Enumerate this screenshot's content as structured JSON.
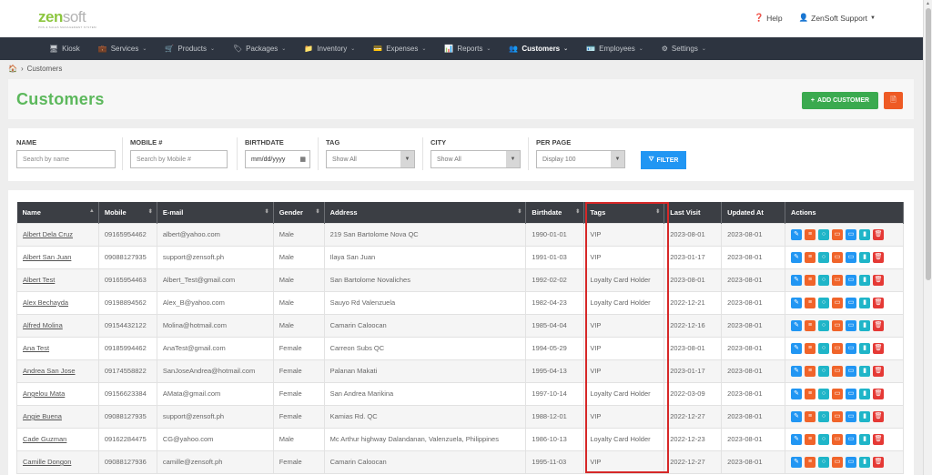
{
  "header": {
    "logo_main_a": "zen",
    "logo_main_b": "soft",
    "logo_sub": "POS & SALES MANAGEMENT SYSTEM",
    "help": "Help",
    "user": "ZenSoft Support"
  },
  "nav": {
    "items": [
      {
        "label": "Kiosk",
        "icon": "desktop-icon"
      },
      {
        "label": "Services",
        "icon": "briefcase-icon"
      },
      {
        "label": "Products",
        "icon": "cart-icon"
      },
      {
        "label": "Packages",
        "icon": "tag-icon"
      },
      {
        "label": "Inventory",
        "icon": "folder-icon"
      },
      {
        "label": "Expenses",
        "icon": "expense-icon"
      },
      {
        "label": "Reports",
        "icon": "chart-icon"
      },
      {
        "label": "Customers",
        "icon": "users-icon"
      },
      {
        "label": "Employees",
        "icon": "id-card-icon"
      },
      {
        "label": "Settings",
        "icon": "gear-icon"
      }
    ],
    "active": "Customers"
  },
  "breadcrumb": {
    "current": "Customers"
  },
  "page": {
    "title": "Customers",
    "add_label": "ADD CUSTOMER"
  },
  "filters": {
    "name": {
      "label": "NAME",
      "placeholder": "Search by name"
    },
    "mobile": {
      "label": "MOBILE #",
      "placeholder": "Search by Mobile #"
    },
    "birthdate": {
      "label": "BIRTHDATE",
      "value": "mm/dd/yyyy"
    },
    "tag": {
      "label": "TAG",
      "value": "Show All"
    },
    "city": {
      "label": "CITY",
      "value": "Show All"
    },
    "per_page": {
      "label": "PER PAGE",
      "value": "Display 100"
    },
    "button": "FILTER"
  },
  "table": {
    "headers": [
      "Name",
      "Mobile",
      "E-mail",
      "Gender",
      "Address",
      "Birthdate",
      "Tags",
      "Last Visit",
      "Updated At",
      "Actions"
    ],
    "rows": [
      [
        "Albert Dela Cruz",
        "09165954462",
        "albert@yahoo.com",
        "Male",
        "219 San Bartolome Nova QC",
        "1990-01-01",
        "VIP",
        "2023-08-01",
        "2023-08-01"
      ],
      [
        "Albert San Juan",
        "09088127935",
        "support@zensoft.ph",
        "Male",
        "Ilaya San Juan",
        "1991-01-03",
        "VIP",
        "2023-01-17",
        "2023-08-01"
      ],
      [
        "Albert Test",
        "09165954463",
        "Albert_Test@gmail.com",
        "Male",
        "San Bartolome Novaliches",
        "1992-02-02",
        "Loyalty Card Holder",
        "2023-08-01",
        "2023-08-01"
      ],
      [
        "Alex Bechayda",
        "09198894562",
        "Alex_B@yahoo.com",
        "Male",
        "Sauyo Rd Valenzuela",
        "1982-04-23",
        "Loyalty Card Holder",
        "2022-12-21",
        "2023-08-01"
      ],
      [
        "Alfred Molina",
        "09154432122",
        "Molina@hotmail.com",
        "Male",
        "Camarin Caloocan",
        "1985-04-04",
        "VIP",
        "2022-12-16",
        "2023-08-01"
      ],
      [
        "Ana Test",
        "09185994462",
        "AnaTest@gmail.com",
        "Female",
        "Carreon Subs QC",
        "1994-05-29",
        "VIP",
        "2023-08-01",
        "2023-08-01"
      ],
      [
        "Andrea San Jose",
        "09174558822",
        "SanJoseAndrea@hotmail.com",
        "Female",
        "Palanan Makati",
        "1995-04-13",
        "VIP",
        "2023-01-17",
        "2023-08-01"
      ],
      [
        "Angelou Mata",
        "09156623384",
        "AMata@gmail.com",
        "Female",
        "San Andrea Marikina",
        "1997-10-14",
        "Loyalty Card Holder",
        "2022-03-09",
        "2023-08-01"
      ],
      [
        "Angie Buena",
        "09088127935",
        "support@zensoft.ph",
        "Female",
        "Kamias Rd. QC",
        "1988-12-01",
        "VIP",
        "2022-12-27",
        "2023-08-01"
      ],
      [
        "Cade Guzman",
        "09162284475",
        "CG@yahoo.com",
        "Male",
        "Mc Arthur highway Dalandanan, Valenzuela, Philippines",
        "1986-10-13",
        "Loyalty Card Holder",
        "2022-12-23",
        "2023-08-01"
      ],
      [
        "Camille Dongon",
        "09088127936",
        "camille@zensoft.ph",
        "Female",
        "Camarin Caloocan",
        "1995-11-03",
        "VIP",
        "2022-12-27",
        "2023-08-01"
      ]
    ]
  },
  "colors": {
    "brand_green": "#5cb85c",
    "nav_bg": "#2d3440",
    "highlight": "#d62828"
  }
}
